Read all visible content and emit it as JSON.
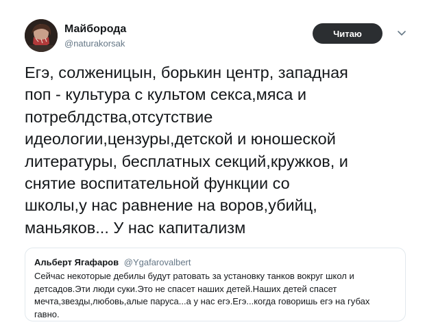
{
  "author": {
    "display_name": "Майборода",
    "username": "@naturakorsak",
    "avatar_icon": "user-avatar"
  },
  "follow_button": {
    "label": "Читаю"
  },
  "menu_icon": "chevron-down-icon",
  "tweet": {
    "lines": [
      "Егэ, солженицын, борькин центр, западная",
      "поп - культура с культом секса,мяса и",
      "потреблдства,отсутствие",
      "идеологии,цензуры,детской и юношеской",
      "литературы, бесплатных секций,кружков, и",
      "снятие воспитательной функции со",
      "школы,у нас равнение на воров,убийц,",
      "маньяков... У нас капитализм"
    ]
  },
  "quoted_tweet": {
    "display_name": "Альберт Ягафаров",
    "username": "@Ygafarovalbert",
    "lines": [
      "Сейчас  некоторые дебилы будут ратовать за установку танков вокруг школ и",
      "детсадов.Эти люди суки.Это не спасет наших детей.Наших детей спасет",
      "мечта,звезды,любовь,алые паруса...а у нас егэ.Егэ...когда говоришь егэ на губах",
      "гавно."
    ]
  },
  "colors": {
    "text": "#14171a",
    "secondary": "#657786",
    "button_bg": "#2b2e31",
    "border": "#e1e8ed"
  }
}
